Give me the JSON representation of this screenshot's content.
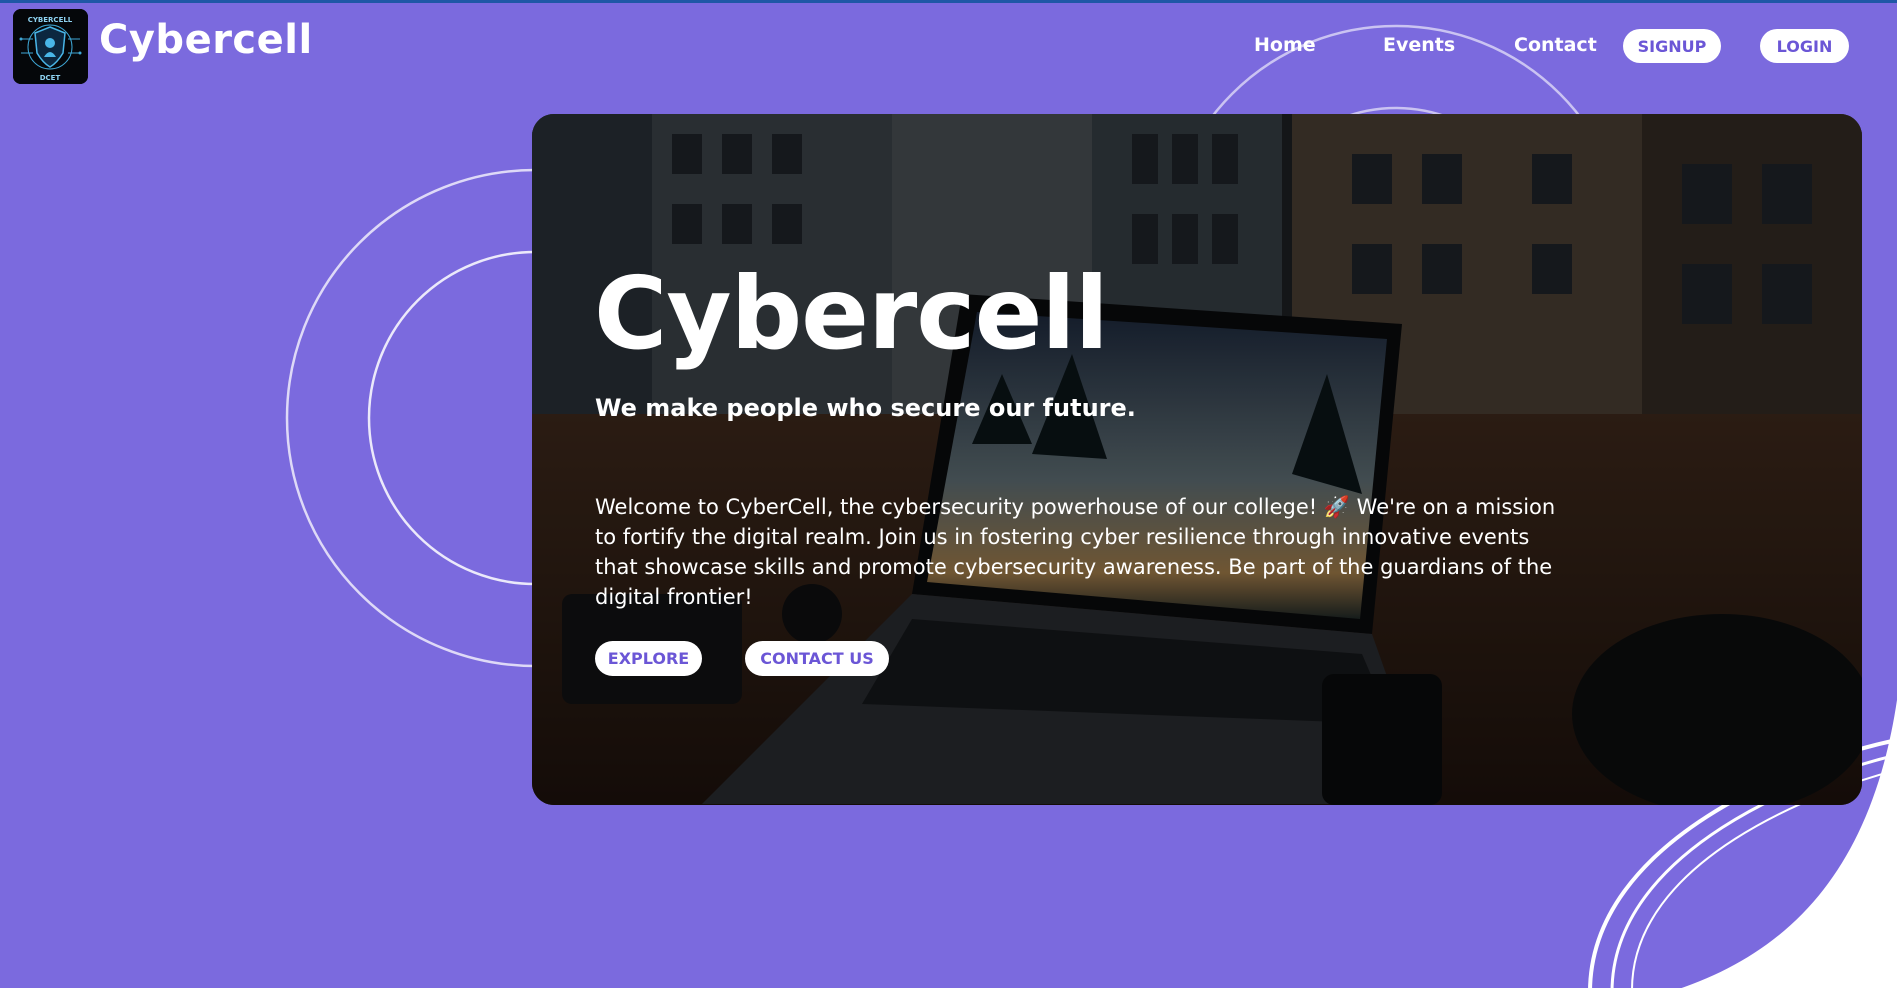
{
  "app": {
    "brand": "Cybercell"
  },
  "colors": {
    "background": "#7b6ade",
    "accent": "#6b56d6",
    "text": "#ffffff"
  },
  "nav": {
    "links": [
      "Home",
      "Events",
      "Contact"
    ],
    "signup_label": "SIGNUP",
    "login_label": "LOGIN"
  },
  "logo": {
    "icon": "cybercell-shield-logo",
    "text_top": "CYBERCELL",
    "text_bottom": "DCET"
  },
  "hero": {
    "title": "Cybercell",
    "subtitle": "We make people who secure our future.",
    "description": "Welcome to CyberCell, the cybersecurity powerhouse of our college! 🚀 We're on a mission to fortify the digital realm. Join us in fostering cyber resilience through innovative events that showcase skills and promote cybersecurity awareness. Be part of the guardians of the digital frontier!",
    "explore_label": "EXPLORE",
    "contact_label": "CONTACT US",
    "background_icon": "laptop-desk-photo"
  }
}
